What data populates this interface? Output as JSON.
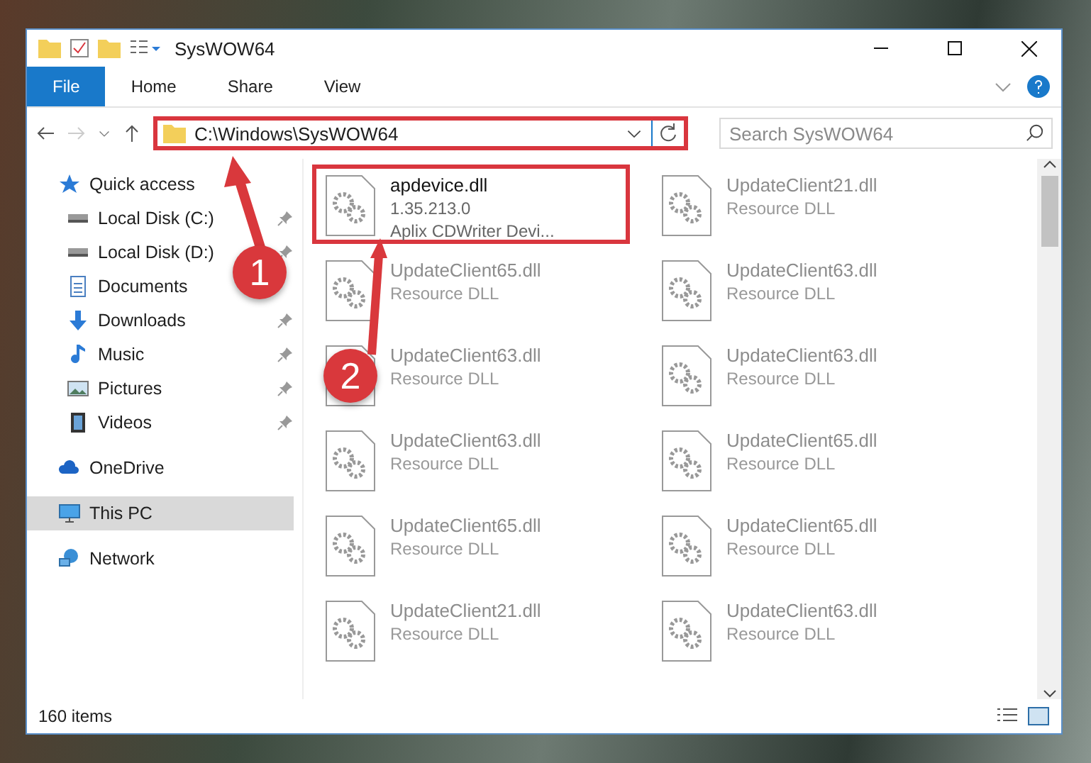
{
  "window": {
    "title": "SysWOW64"
  },
  "ribbon_tabs": [
    {
      "label": "File",
      "selected": true
    },
    {
      "label": "Home",
      "selected": false
    },
    {
      "label": "Share",
      "selected": false
    },
    {
      "label": "View",
      "selected": false
    }
  ],
  "address": {
    "path": "C:\\Windows\\SysWOW64",
    "highlighted": true
  },
  "search": {
    "placeholder": "Search SysWOW64"
  },
  "sidebar": {
    "items": [
      {
        "label": "Quick access",
        "kind": "star",
        "selected": false,
        "children": [
          {
            "label": "Local Disk (C:)",
            "kind": "disk",
            "pinned": true,
            "selected": false
          },
          {
            "label": "Local Disk (D:)",
            "kind": "disk",
            "pinned": true,
            "selected": false
          },
          {
            "label": "Documents",
            "kind": "doc",
            "pinned": false,
            "selected": false
          },
          {
            "label": "Downloads",
            "kind": "download",
            "pinned": true,
            "selected": false
          },
          {
            "label": "Music",
            "kind": "music",
            "pinned": true,
            "selected": false
          },
          {
            "label": "Pictures",
            "kind": "picture",
            "pinned": true,
            "selected": false
          },
          {
            "label": "Videos",
            "kind": "video",
            "pinned": true,
            "selected": false
          }
        ]
      },
      {
        "label": "OneDrive",
        "kind": "cloud",
        "selected": false
      },
      {
        "label": "This PC",
        "kind": "pc",
        "selected": true
      },
      {
        "label": "Network",
        "kind": "network",
        "selected": false
      }
    ]
  },
  "files": [
    {
      "name": "apdevice.dll",
      "lines": [
        "1.35.213.0",
        "Aplix CDWriter Devi..."
      ],
      "selected": true
    },
    {
      "name": "UpdateClient21.dll",
      "lines": [
        "Resource DLL"
      ],
      "selected": false
    },
    {
      "name": "UpdateClient65.dll",
      "lines": [
        "Resource DLL"
      ],
      "selected": false
    },
    {
      "name": "UpdateClient63.dll",
      "lines": [
        "Resource DLL"
      ],
      "selected": false
    },
    {
      "name": "UpdateClient63.dll",
      "lines": [
        "Resource DLL"
      ],
      "selected": false
    },
    {
      "name": "UpdateClient63.dll",
      "lines": [
        "Resource DLL"
      ],
      "selected": false
    },
    {
      "name": "UpdateClient63.dll",
      "lines": [
        "Resource DLL"
      ],
      "selected": false
    },
    {
      "name": "UpdateClient65.dll",
      "lines": [
        "Resource DLL"
      ],
      "selected": false
    },
    {
      "name": "UpdateClient65.dll",
      "lines": [
        "Resource DLL"
      ],
      "selected": false
    },
    {
      "name": "UpdateClient65.dll",
      "lines": [
        "Resource DLL"
      ],
      "selected": false
    },
    {
      "name": "UpdateClient21.dll",
      "lines": [
        "Resource DLL"
      ],
      "selected": false
    },
    {
      "name": "UpdateClient63.dll",
      "lines": [
        "Resource DLL"
      ],
      "selected": false
    }
  ],
  "status_bar": {
    "count": "160 items"
  },
  "annotations": [
    {
      "number": "1"
    },
    {
      "number": "2"
    }
  ]
}
